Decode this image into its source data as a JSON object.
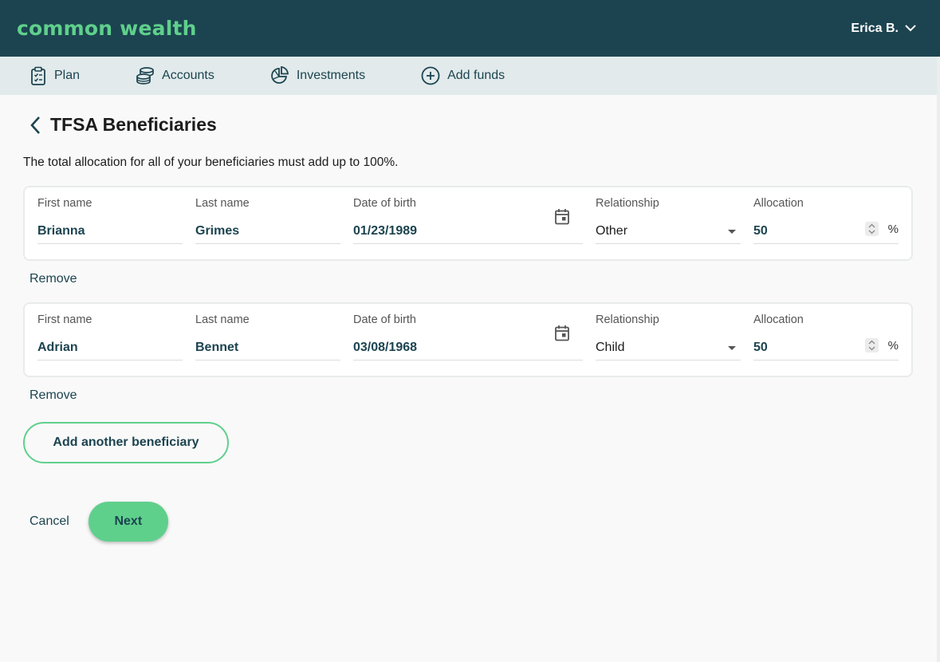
{
  "brand": {
    "logo_text": "common wealth",
    "accent": "#5fd08c",
    "primary": "#1c4450"
  },
  "user": {
    "name": "Erica B."
  },
  "nav": [
    {
      "label": "Plan",
      "icon": "clipboard-icon"
    },
    {
      "label": "Accounts",
      "icon": "coins-icon"
    },
    {
      "label": "Investments",
      "icon": "pie-chart-icon"
    },
    {
      "label": "Add funds",
      "icon": "plus-circle-icon"
    }
  ],
  "page": {
    "title": "TFSA Beneficiaries",
    "intro": "The total allocation for all of your beneficiaries must add up to 100%."
  },
  "labels": {
    "first_name": "First name",
    "last_name": "Last name",
    "dob": "Date of birth",
    "relationship": "Relationship",
    "allocation": "Allocation",
    "percent": "%",
    "remove": "Remove"
  },
  "beneficiaries": [
    {
      "first_name": "Brianna",
      "last_name": "Grimes",
      "dob": "01/23/1989",
      "relationship": "Other",
      "allocation": "50"
    },
    {
      "first_name": "Adrian",
      "last_name": "Bennet",
      "dob": "03/08/1968",
      "relationship": "Child",
      "allocation": "50"
    }
  ],
  "buttons": {
    "add_beneficiary": "Add another beneficiary",
    "cancel": "Cancel",
    "next": "Next"
  }
}
